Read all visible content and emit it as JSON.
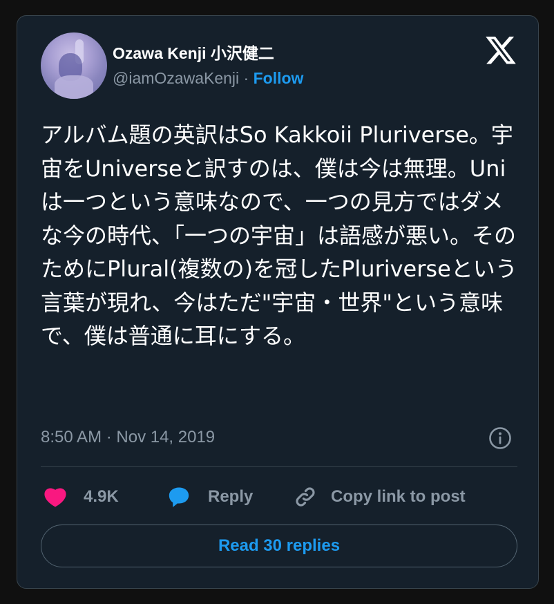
{
  "author": {
    "display_name": "Ozawa Kenji 小沢健二",
    "handle": "@iamOzawaKenji",
    "separator": "·",
    "follow_label": "Follow",
    "avatar_icon": "profile-photo"
  },
  "tweet": {
    "text": "アルバム題の英訳はSo Kakkoii Pluriverse。宇宙をUniverseと訳すのは、僕は今は無理。Uniは一つという意味なので、一つの見方ではダメな今の時代、「一つの宇宙」は語感が悪い。そのためにPlural(複数の)を冠したPluriverseという言葉が現れ、今はただ\"宇宙・世界\"という意味で、僕は普通に耳にする。",
    "timestamp": "8:50 AM · Nov 14, 2019"
  },
  "actions": {
    "like_count": "4.9K",
    "reply_label": "Reply",
    "copy_link_label": "Copy link to post"
  },
  "read_replies_label": "Read 30 replies",
  "colors": {
    "background": "#15202b",
    "accent": "#1d9bf0",
    "like": "#f91880",
    "muted": "#8b98a5",
    "border": "#38444d"
  }
}
